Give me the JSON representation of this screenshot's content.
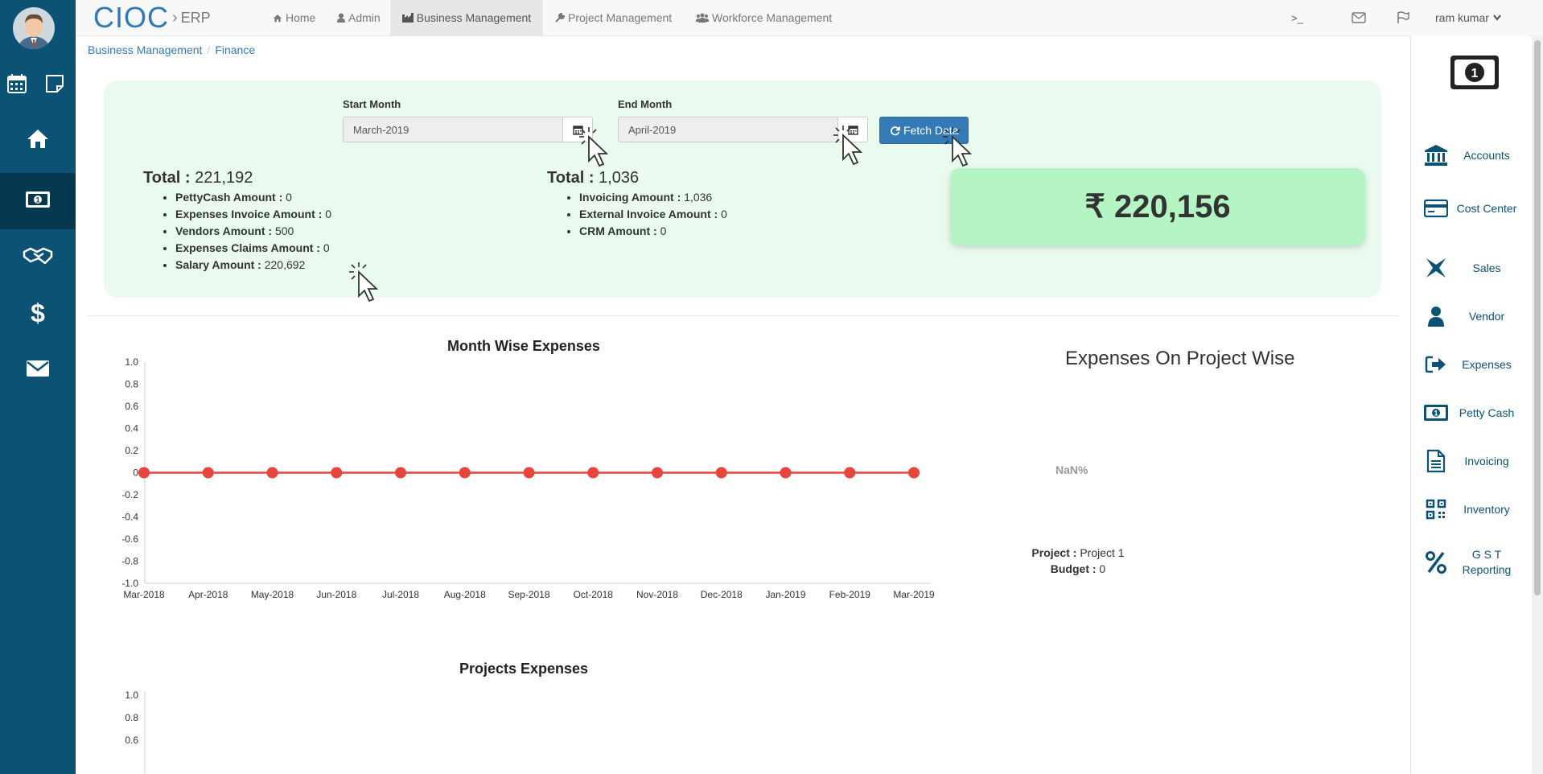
{
  "app": {
    "brand": "CIOC",
    "brand_suffix": "ERP"
  },
  "left_sidebar": {
    "items": [
      {
        "icon": "calendar-icon"
      },
      {
        "icon": "notes-icon"
      },
      {
        "icon": "home-icon"
      },
      {
        "icon": "money-icon",
        "active": true
      },
      {
        "icon": "handshake-icon"
      },
      {
        "icon": "dollar-icon"
      },
      {
        "icon": "envelope-icon"
      }
    ]
  },
  "nav": {
    "items": [
      {
        "label": "Home",
        "icon": "home-icon"
      },
      {
        "label": "Admin",
        "icon": "user-icon"
      },
      {
        "label": "Business Management",
        "icon": "industry-icon",
        "active": true
      },
      {
        "label": "Project Management",
        "icon": "wrench-icon"
      },
      {
        "label": "Workforce Management",
        "icon": "users-icon"
      }
    ],
    "terminal": ">_",
    "user": "ram kumar"
  },
  "breadcrumb": [
    "Business Management",
    "Finance"
  ],
  "filters": {
    "start_label": "Start Month",
    "start_value": "March-2019",
    "end_label": "End Month",
    "end_value": "April-2019",
    "fetch_label": "Fetch Data"
  },
  "expenses": {
    "total_label": "Total :",
    "total": "221,192",
    "items": [
      {
        "label": "PettyCash Amount :",
        "value": "0"
      },
      {
        "label": "Expenses Invoice Amount :",
        "value": "0"
      },
      {
        "label": "Vendors Amount :",
        "value": "500"
      },
      {
        "label": "Expenses Claims Amount :",
        "value": "0"
      },
      {
        "label": "Salary Amount :",
        "value": "220,692"
      }
    ]
  },
  "income": {
    "total_label": "Total :",
    "total": "1,036",
    "items": [
      {
        "label": "Invoicing Amount :",
        "value": "1,036"
      },
      {
        "label": "External Invoice Amount :",
        "value": "0"
      },
      {
        "label": "CRM Amount :",
        "value": "0"
      }
    ]
  },
  "net": {
    "value": "₹ 220,156"
  },
  "pie": {
    "title": "Expenses On Project Wise",
    "label": "NaN%",
    "project_label": "Project :",
    "project_value": "Project 1",
    "budget_label": "Budget :",
    "budget_value": "0"
  },
  "right_sidebar": {
    "top_icon": "money-icon",
    "items": [
      {
        "label": "Accounts",
        "icon": "bank-icon"
      },
      {
        "label": "Cost Center",
        "icon": "credit-card-icon"
      },
      {
        "label": "Sales",
        "icon": "sales-icon"
      },
      {
        "label": "Vendor",
        "icon": "user-icon"
      },
      {
        "label": "Expenses",
        "icon": "sign-out-icon"
      },
      {
        "label": "Petty Cash",
        "icon": "money-icon"
      },
      {
        "label": "Invoicing",
        "icon": "document-icon"
      },
      {
        "label": "Inventory",
        "icon": "qrcode-icon"
      },
      {
        "label": "G S T Reporting",
        "icon": "percent-icon"
      }
    ]
  },
  "colors": {
    "sidebar": "#0b5275",
    "line": "#e8453c",
    "panel": "#eafaef",
    "net_card": "#b5f5c4"
  },
  "chart_data": [
    {
      "type": "line",
      "title": "Month Wise Expenses",
      "categories": [
        "Mar-2018",
        "Apr-2018",
        "May-2018",
        "Jun-2018",
        "Jul-2018",
        "Aug-2018",
        "Sep-2018",
        "Oct-2018",
        "Nov-2018",
        "Dec-2018",
        "Jan-2019",
        "Feb-2019",
        "Mar-2019"
      ],
      "values": [
        0,
        0,
        0,
        0,
        0,
        0,
        0,
        0,
        0,
        0,
        0,
        0,
        0
      ],
      "yticks": [
        "1.0",
        "0.8",
        "0.6",
        "0.4",
        "0.2",
        "0",
        "-0.2",
        "-0.4",
        "-0.6",
        "-0.8",
        "-1.0"
      ],
      "ylim": [
        -1,
        1
      ]
    },
    {
      "type": "bar",
      "title": "Projects Expenses",
      "yticks": [
        "1.0",
        "0.8",
        "0.6"
      ]
    }
  ]
}
